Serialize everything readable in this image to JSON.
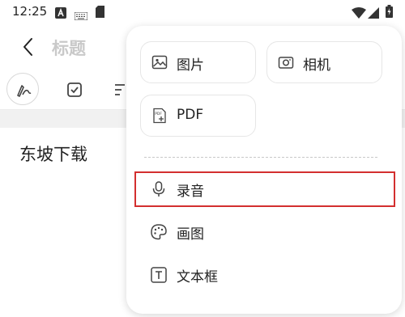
{
  "status_bar": {
    "time": "12:25"
  },
  "header": {
    "title": "标题"
  },
  "note": {
    "text": "东坡下载"
  },
  "menu": {
    "cards": [
      {
        "label": "图片",
        "icon": "image-icon"
      },
      {
        "label": "相机",
        "icon": "camera-icon"
      },
      {
        "label": "PDF",
        "icon": "pdf-icon"
      }
    ],
    "items": [
      {
        "label": "录音",
        "icon": "microphone-icon",
        "highlighted": true
      },
      {
        "label": "画图",
        "icon": "palette-icon"
      },
      {
        "label": "文本框",
        "icon": "text-box-icon"
      }
    ]
  },
  "colors": {
    "highlight": "#d32f2f",
    "title_placeholder": "#c9c9c9"
  }
}
